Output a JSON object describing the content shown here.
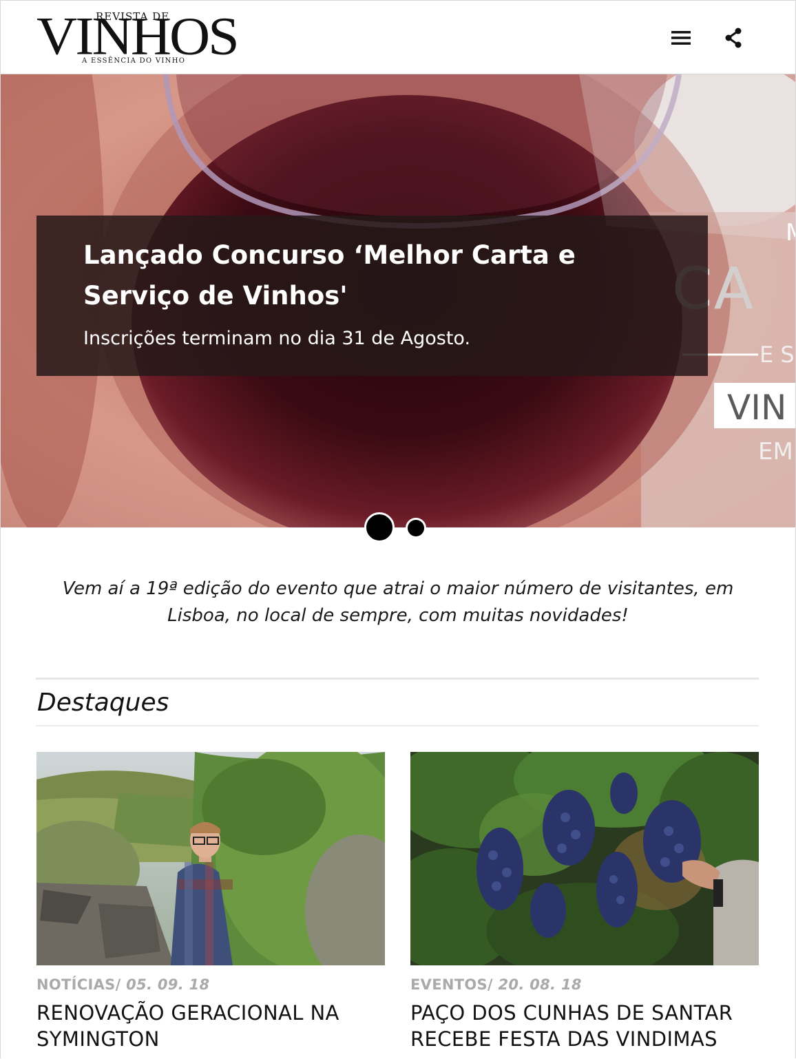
{
  "header": {
    "logo_top": "REVISTA DE",
    "logo_main": "VINHOS",
    "logo_tagline": "A ESSÊNCIA DO VINHO",
    "menu_icon": "hamburger-menu-icon",
    "share_icon": "share-icon"
  },
  "hero": {
    "title": "Lançado Concurso ‘Melhor Carta e Serviço de Vinhos'",
    "subtitle": "Inscrições terminam no dia 31 de Agosto.",
    "poster_fragments": [
      "M",
      "CA",
      "E S",
      "VIN",
      "EM"
    ],
    "slides_total": 2,
    "active_slide": 1
  },
  "intro": "Vem aí a 19ª edição do evento que atrai o maior número de visitantes, em Lisboa, no local de sempre, com muitas novidades!",
  "section": {
    "title": "Destaques"
  },
  "cards": [
    {
      "category": "NOTÍCIAS/",
      "date": "05. 09. 18",
      "title": "RENOVAÇÃO GERACIONAL NA SYMINGTON"
    },
    {
      "category": "EVENTOS/",
      "date": "20. 08. 18",
      "title": "PAÇO DOS CUNHAS DE SANTAR RECEBE FESTA DAS VINDIMAS"
    }
  ],
  "colors": {
    "hero_overlay": "#261919",
    "meta_gray": "#aaaaaa",
    "wine": "#3a0d14"
  }
}
